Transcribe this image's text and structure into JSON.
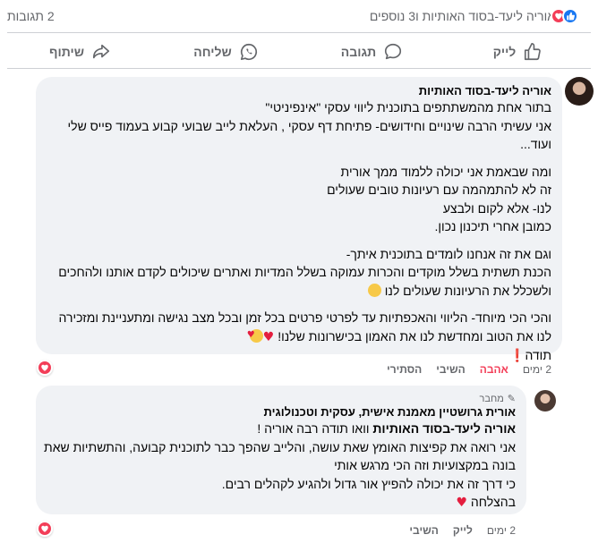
{
  "reactions": {
    "names": "אוריה ליעד-בסוד האותיות ו3 נוספים",
    "comment_count": "2 תגובות",
    "icons": [
      "like-icon",
      "love-icon"
    ]
  },
  "actions": {
    "like": "לייק",
    "comment": "תגובה",
    "send": "שליחה",
    "share": "שיתוף"
  },
  "comments": [
    {
      "author": "אוריה ליעד-בסוד האותיות",
      "lines": [
        "בתור אחת מהמשתתפים בתוכנית ליווי עסקי \"אינפיניטי\"",
        "אני עשיתי הרבה שינויים וחידושים- פתיחת דף עסקי , העלאת לייב שבועי קבוע בעמוד פייס שלי",
        "ועוד...",
        "ומה שבאמת אני יכולה ללמוד ממך אורית",
        "זה לא להתמהמה עם רעיונות טובים שעולים",
        "לנו- אלא לקום ולבצע",
        "כמובן אחרי תיכנון נכון.",
        "וגם את זה אנחנו לומדים בתוכנית איתך-",
        "הכנת תשתית בשלל מוקדים והכרות עמוקה בשלל המדיות ואתרים שיכולים לקדם אותנו ולהחכים",
        "ולשכלל את הרעיונות שעולים לנו",
        "והכי הכי מיוחד- הליווי והאכפתיות עד לפרטי פרטים בכל זמן ובכל מצב נגישה ומתעניינת ומזכירה",
        "לנו את הטוב ומחדשת לנו את האמון בכישרונות שלנו!",
        "תודה"
      ],
      "meta": {
        "time": "2 ימים",
        "love": "אהבה",
        "reply": "השיבי",
        "hide": "הסתירי"
      }
    },
    {
      "badge": "מחבר",
      "author": "אורית גרושטיין מאמנת אישית, עסקית וטכנולוגית",
      "mention": "אוריה ליעד-בסוד האותיות",
      "mention_suffix": " וואו תודה רבה אוריה !",
      "lines": [
        "אני רואה את קפיצות האומץ שאת עושה, והלייב שהפך כבר לתוכנית קבועה, והתשתיות שאת",
        "בונה במקצועיות וזה הכי מרגש אותי",
        "כי דרך זה את יכולה להפיץ אור גדול ולהגיע לקהלים רבים.",
        "בהצלחה"
      ],
      "meta": {
        "time": "2 ימים",
        "like": "לייק",
        "reply": "השיבי"
      }
    }
  ],
  "colors": {
    "like_blue": "#1877f2",
    "love_red": "#f33e58",
    "bubble_bg": "#f0f2f5",
    "meta_gray": "#65676b"
  }
}
